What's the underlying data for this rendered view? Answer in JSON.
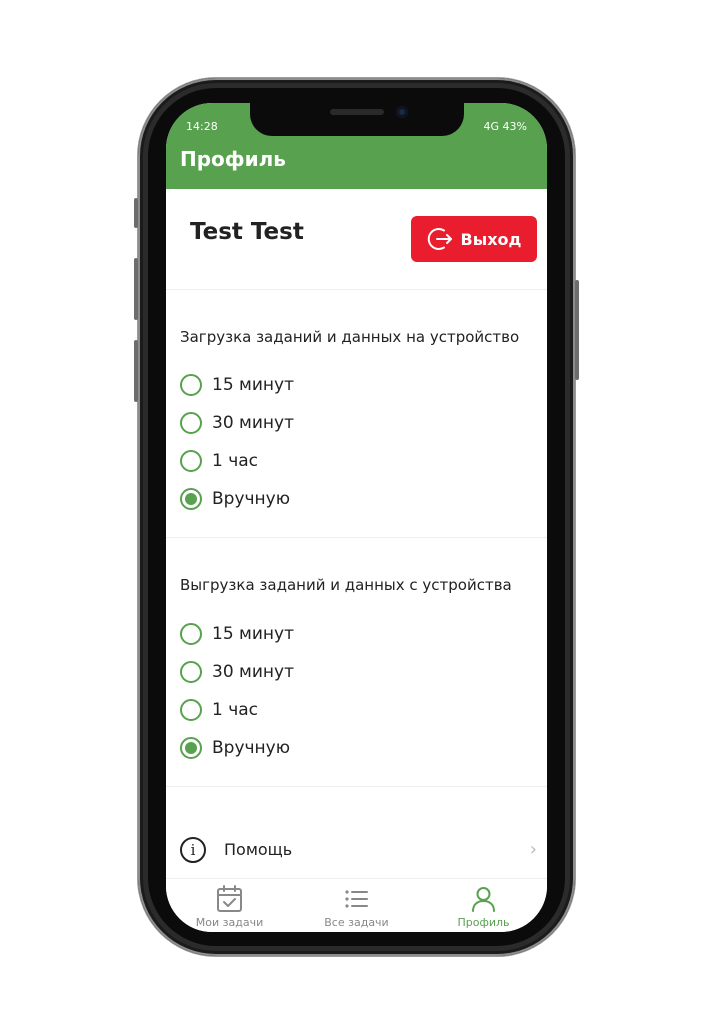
{
  "status_bar": {
    "time": "14:28",
    "network": "4G 43%"
  },
  "header": {
    "title": "Профиль"
  },
  "profile": {
    "name": "Test Test",
    "logout_label": "Выход"
  },
  "download_section": {
    "title": "Загрузка заданий и данных на устройство",
    "options": [
      "15 минут",
      "30 минут",
      "1 час",
      "Вручную"
    ],
    "selected": "Вручную"
  },
  "upload_section": {
    "title": "Выгрузка заданий и данных с устройства",
    "options": [
      "15 минут",
      "30 минут",
      "1 час",
      "Вручную"
    ],
    "selected": "Вручную"
  },
  "help": {
    "label": "Помощь"
  },
  "tabs": [
    {
      "label": "Мои задачи",
      "icon": "calendar-check-icon",
      "active": false
    },
    {
      "label": "Все задачи",
      "icon": "list-icon",
      "active": false
    },
    {
      "label": "Профиль",
      "icon": "person-icon",
      "active": true
    }
  ],
  "colors": {
    "accent": "#58a14e",
    "danger": "#ea1d2f",
    "inactive": "#888888"
  }
}
